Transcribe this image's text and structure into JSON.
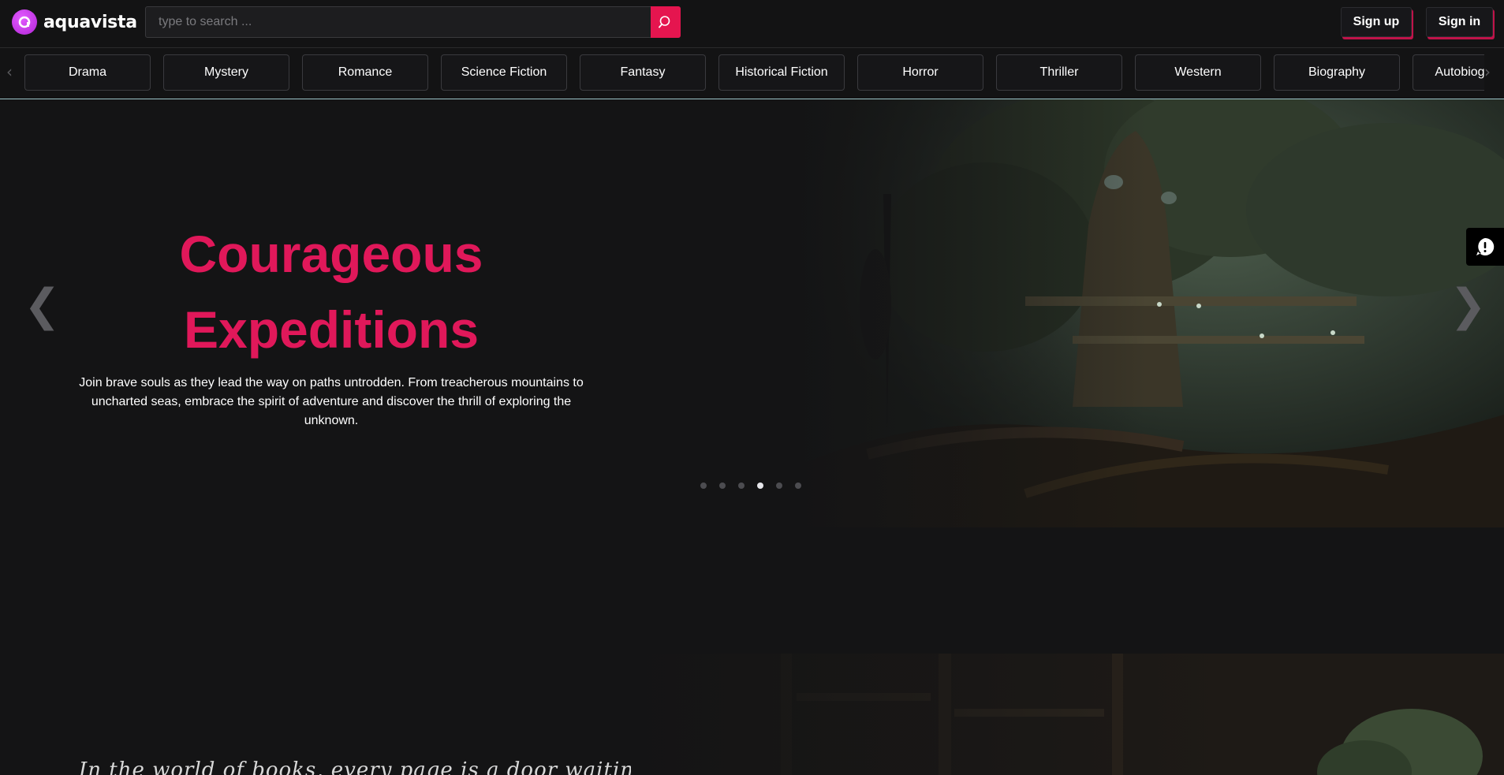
{
  "header": {
    "brand": "aquavista",
    "search_placeholder": "type to search ...",
    "search_value": "",
    "signup_label": "Sign up",
    "signin_label": "Sign in"
  },
  "genres": [
    "Drama",
    "Mystery",
    "Romance",
    "Science Fiction",
    "Fantasy",
    "Historical Fiction",
    "Horror",
    "Thriller",
    "Western",
    "Biography",
    "Autobiography"
  ],
  "hero": {
    "title_line1": "Courageous",
    "title_line2": "Expeditions",
    "description": "Join brave souls as they lead the way on paths untrodden. From treacherous mountains to uncharted seas, embrace the spirit of adventure and discover the thrill of exploring the unknown.",
    "slide_count": 6,
    "active_slide": 4
  },
  "icons": {
    "search": "search-icon",
    "prev": "chevron-left-icon",
    "next": "chevron-right-icon",
    "feedback": "feedback-icon"
  },
  "colors": {
    "accent": "#e0185a",
    "logo": "#c23be6",
    "background": "#141415"
  },
  "lower": {
    "tagline": "In the world of books, every page is a door waiting to be opened"
  }
}
